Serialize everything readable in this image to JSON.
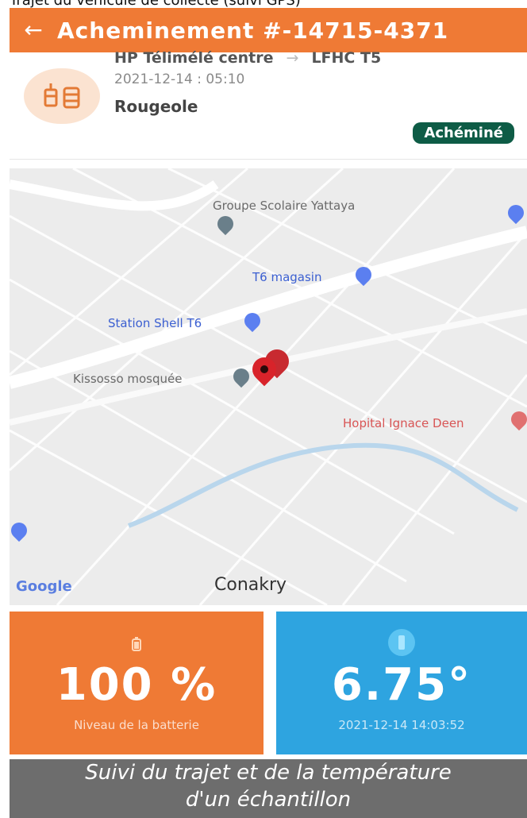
{
  "top_strip_text": "Trajet du véhicule de collecte (suivi GPS)",
  "appbar": {
    "back_icon": "arrow-left-icon",
    "title": "Acheminement #-14715-4371"
  },
  "shipment": {
    "icon": "vaccine-vial-icon",
    "origin": "HP Télimélé centre",
    "destination": "LFHC T5",
    "datetime": "2021-12-14 : 05:10",
    "disease": "Rougeole",
    "status": "Achéminé",
    "status_color": "#0e5c46"
  },
  "map": {
    "pois": [
      "Groupe Scolaire Yattaya",
      "T6 magasin",
      "Station Shell T6",
      "Kissosso mosquée",
      "Hopital Ignace Deen"
    ],
    "city": "Conakry",
    "attribution": "Google",
    "marker_color": "#d8232a"
  },
  "battery": {
    "icon": "battery-icon",
    "value": "100 %",
    "label": "Niveau de la batterie",
    "color": "#ef7a35"
  },
  "temperature": {
    "icon": "thermometer-icon",
    "value": "6.75°",
    "timestamp": "2021-12-14 14:03:52",
    "color": "#2ea4e0"
  },
  "caption": {
    "line1": "Suivi du trajet et de la température",
    "line2": "d'un échantillon"
  }
}
